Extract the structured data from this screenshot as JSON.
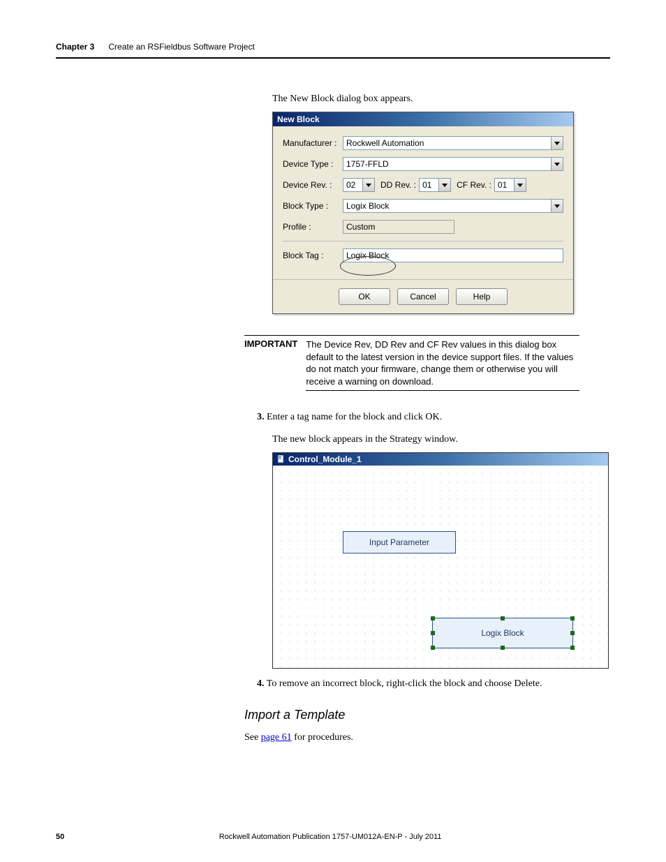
{
  "header": {
    "chapter_label": "Chapter 3",
    "chapter_title": "Create an RSFieldbus Software Project"
  },
  "intro_text": "The New Block dialog box appears.",
  "dialog": {
    "title": "New Block",
    "fields": {
      "manufacturer_label": "Manufacturer :",
      "manufacturer_value": "Rockwell Automation",
      "device_type_label": "Device Type :",
      "device_type_value": "1757-FFLD",
      "device_rev_label": "Device Rev. :",
      "device_rev_value": "02",
      "dd_rev_label": "DD Rev. :",
      "dd_rev_value": "01",
      "cf_rev_label": "CF Rev. :",
      "cf_rev_value": "01",
      "block_type_label": "Block Type :",
      "block_type_value": "Logix Block",
      "profile_label": "Profile :",
      "profile_value": "Custom",
      "block_tag_label": "Block Tag :",
      "block_tag_value": "Logix Block"
    },
    "buttons": {
      "ok": "OK",
      "cancel": "Cancel",
      "help": "Help"
    }
  },
  "important": {
    "label": "IMPORTANT",
    "text": "The Device Rev, DD Rev and CF Rev values in this dialog box default to the latest version in the device support files. If the values do not match your firmware, change them or otherwise you will receive a warning on download."
  },
  "step3": {
    "num": "3.",
    "text": "Enter a tag name for the block and click OK."
  },
  "post_step3": "The new block appears in the Strategy window.",
  "strategy": {
    "title": "Control_Module_1",
    "input_parameter": "Input Parameter",
    "logix_block": "Logix Block"
  },
  "step4": {
    "num": "4.",
    "text": "To remove an incorrect block, right-click the block and choose Delete."
  },
  "subhead": "Import a Template",
  "see_text_prefix": "See ",
  "see_link": "page 61",
  "see_text_suffix": " for procedures.",
  "footer": {
    "page_number": "50",
    "pub": "Rockwell Automation Publication 1757-UM012A-EN-P - July 2011"
  }
}
